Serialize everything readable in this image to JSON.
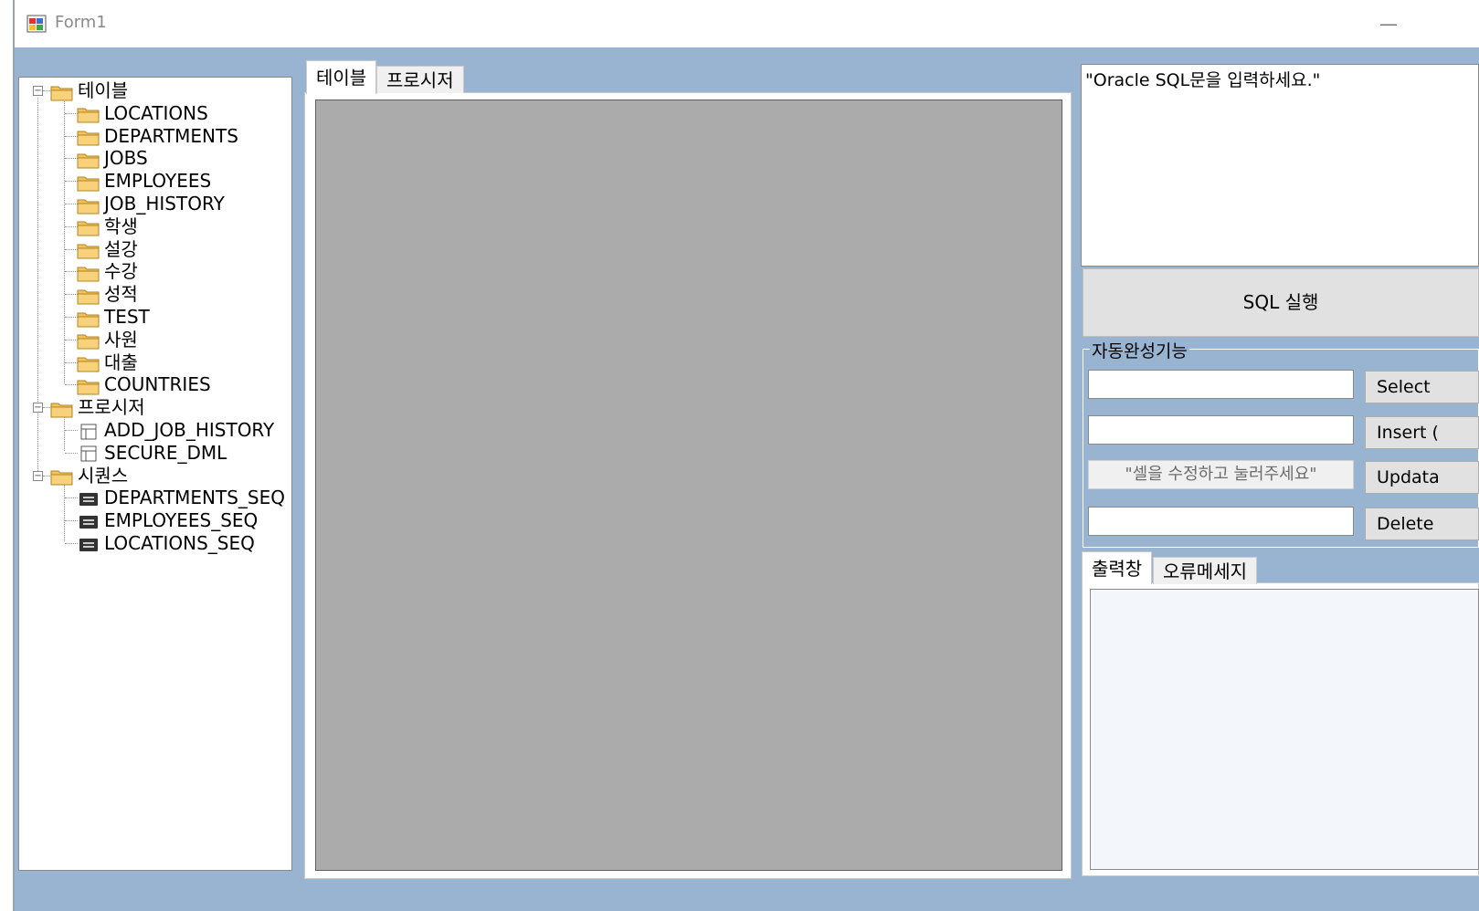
{
  "window": {
    "title": "Form1",
    "minimize_glyph": "—"
  },
  "tree": {
    "groups": [
      {
        "label": "테이블",
        "icon": "folder-icon",
        "children": [
          "LOCATIONS",
          "DEPARTMENTS",
          "JOBS",
          "EMPLOYEES",
          "JOB_HISTORY",
          "학생",
          "설강",
          "수강",
          "성적",
          "TEST",
          "사원",
          "대출",
          "COUNTRIES"
        ]
      },
      {
        "label": "프로시저",
        "icon": "folder-icon",
        "children": [
          "ADD_JOB_HISTORY",
          "SECURE_DML"
        ]
      },
      {
        "label": "시퀀스",
        "icon": "folder-icon",
        "children": [
          "DEPARTMENTS_SEQ",
          "EMPLOYEES_SEQ",
          "LOCATIONS_SEQ"
        ]
      }
    ],
    "expander_glyph": "−"
  },
  "main_tabs": [
    {
      "label": "테이블",
      "active": true
    },
    {
      "label": "프로시저",
      "active": false
    }
  ],
  "sql": {
    "input_value": "\"Oracle SQL문을 입력하세요.\"",
    "run_label": "SQL 실행"
  },
  "autocomplete": {
    "legend": "자동완성기능",
    "select_value": "",
    "insert_value": "",
    "update_hint": "\"셀을 수정하고 눌러주세요\"",
    "delete_value": "",
    "select_label": "Select",
    "insert_label": "Insert (",
    "update_label": "Updata",
    "delete_label": "Delete"
  },
  "output_tabs": [
    {
      "label": "출력창",
      "active": true
    },
    {
      "label": "오류메세지",
      "active": false
    }
  ],
  "output_text": "",
  "colors": {
    "form_back": "#99b4d1",
    "grid_back": "#ababab",
    "folder": "#f5c25a"
  }
}
